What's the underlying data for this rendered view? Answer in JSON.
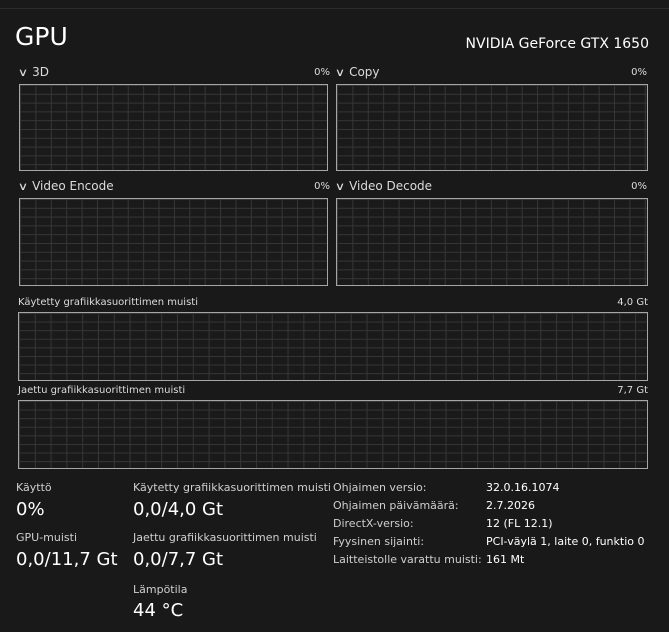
{
  "header": {
    "title": "GPU",
    "device_name": "NVIDIA GeForce GTX 1650"
  },
  "engines": [
    {
      "label": "3D",
      "percent": "0%"
    },
    {
      "label": "Copy",
      "percent": "0%"
    },
    {
      "label": "Video Encode",
      "percent": "0%"
    },
    {
      "label": "Video Decode",
      "percent": "0%"
    }
  ],
  "dedicated_memory_graph": {
    "label": "Käytetty grafiikkasuorittimen muisti",
    "max": "4,0 Gt"
  },
  "shared_memory_graph": {
    "label": "Jaettu grafiikkasuorittimen muisti",
    "max": "7,7 Gt"
  },
  "stats": {
    "utilization": {
      "label": "Käyttö",
      "value": "0%"
    },
    "gpu_memory": {
      "label": "GPU-muisti",
      "value": "0,0/11,7 Gt"
    },
    "dedicated_memory": {
      "label": "Käytetty grafiikkasuorittimen muisti",
      "value": "0,0/4,0 Gt"
    },
    "shared_memory": {
      "label": "Jaettu grafiikkasuorittimen muisti",
      "value": "0,0/7,7 Gt"
    },
    "temperature": {
      "label": "Lämpötila",
      "value": "44 °C"
    }
  },
  "info": [
    {
      "key": "Ohjaimen versio:",
      "value": "32.0.16.1074"
    },
    {
      "key": "Ohjaimen päivämäärä:",
      "value": "2.7.2026"
    },
    {
      "key": "DirectX-versio:",
      "value": "12 (FL 12.1)"
    },
    {
      "key": "Fyysinen sijainti:",
      "value": "PCI-väylä 1, laite 0, funktio 0"
    },
    {
      "key": "Laitteistolle varattu muisti:",
      "value": "161 Mt"
    }
  ]
}
